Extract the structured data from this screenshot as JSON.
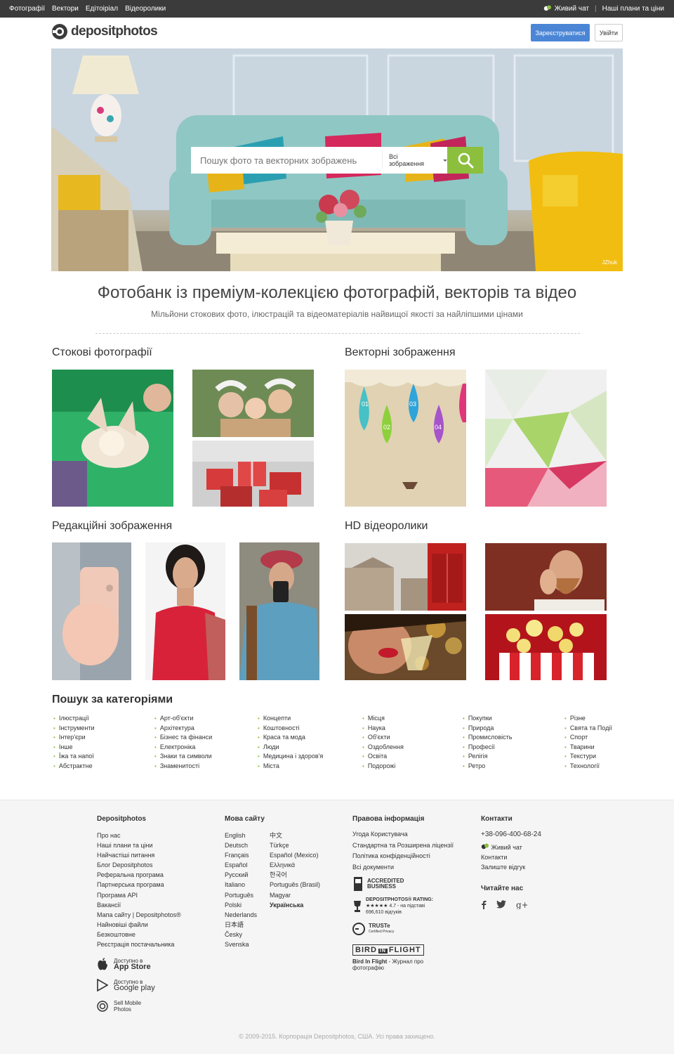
{
  "topbar": {
    "nav": [
      "Фотографії",
      "Вектори",
      "Едітоіріал",
      "Відеоролики"
    ],
    "live_chat": "Живий чат",
    "plans": "Наші плани та ціни"
  },
  "header": {
    "logo_text": "depositphotos",
    "register_label": "Зареєструватися",
    "login_label": "Увійти"
  },
  "hero": {
    "search_placeholder": "Пошук фото та векторних зображень",
    "filter_selected": "Всі зображення",
    "photo_credit": "JZhuk"
  },
  "headline": "Фотобанк із преміум-колекцією фотографій, векторів та відео",
  "subline": "Мільйони стокових фото, ілюстрацій та відеоматеріалів найвищої якості за найліпшими цінами",
  "sections": {
    "stock_photos": "Стокові фотографії",
    "vectors": "Векторні зображення",
    "editorial": "Редакційні зображення",
    "videos": "HD відеоролики"
  },
  "categories": {
    "title": "Пошук за категоріями",
    "columns": [
      [
        "Ілюстрації",
        "Інструменти",
        "Інтер'єри",
        "Інше",
        "Їжа та напої",
        "Абстрактне"
      ],
      [
        "Арт-об'єкти",
        "Архітектура",
        "Бізнес та фінанси",
        "Електроніка",
        "Знаки та символи",
        "Знаменитості"
      ],
      [
        "Концепти",
        "Коштовності",
        "Краса та мода",
        "Люди",
        "Медицина і здоров'я",
        "Міста"
      ],
      [
        "Місця",
        "Наука",
        "Об'єкти",
        "Оздоблення",
        "Освіта",
        "Подорожі"
      ],
      [
        "Покупки",
        "Природа",
        "Промисловість",
        "Професії",
        "Релігія",
        "Ретро"
      ],
      [
        "Різне",
        "Свята та Події",
        "Спорт",
        "Тварини",
        "Текстури",
        "Технології"
      ]
    ]
  },
  "footer": {
    "col1": {
      "title": "Depositphotos",
      "links": [
        "Про нас",
        "Наші плани та ціни",
        "Найчастіші питання",
        "Блог Depositphotos",
        "Реферальна програма",
        "Партнерська програма",
        "Програма API",
        "Вакансії",
        "Мапа сайту | Depositphotos®",
        "Найновіші файли",
        "Безкоштовне",
        "Реєстрація постачальника"
      ],
      "app_store_small": "Доступно в",
      "app_store": "App Store",
      "google_play_small": "Доступно в",
      "google_play": "Google play",
      "sell_mobile": "Sell Mobile Photos"
    },
    "col2": {
      "title": "Мова сайту",
      "langs_left": [
        "English",
        "Deutsch",
        "Français",
        "Español",
        "Русский",
        "Italiano",
        "Português",
        "Polski",
        "Nederlands",
        "日本語",
        "Česky",
        "Svenska"
      ],
      "langs_right": [
        "中文",
        "Türkçe",
        "Español (Mexico)",
        "Ελληνικά",
        "한국어",
        "Português (Brasil)",
        "Magyar",
        "Українська"
      ]
    },
    "col3": {
      "title": "Правова інформація",
      "links": [
        "Угода Користувача",
        "Стандартна та Розширена ліцензії",
        "Політика конфіденційності",
        "Всі документи"
      ],
      "bbb_line1": "ACCREDITED",
      "bbb_line2": "BUSINESS",
      "rating_title": "DEPOSITPHOTOS® RATING:",
      "rating_value": "4.7",
      "rating_suffix": "- на підставі",
      "rating_reviews": "696,610 відгуків",
      "truste": "TRUSTe",
      "truste_sub": "Certified Privacy",
      "bif_logo_a": "BIRD",
      "bif_logo_b": "IN",
      "bif_logo_c": "FLIGHT",
      "bif_name": "Bird In Flight",
      "bif_desc": "- Журнал про фотографію"
    },
    "col4": {
      "title": "Контакти",
      "phone": "+38-096-400-68-24",
      "live_chat": "Живий чат",
      "contacts": "Контакти",
      "feedback": "Залиште відгук",
      "follow_title": "Читайте нас"
    },
    "copyright": "© 2009-2015. Корпорація Depositphotos, США. Усі права захищено."
  },
  "colors": {
    "topbar": "#3b3b3b",
    "accent_green": "#8bbf3d",
    "register_blue": "#4b86d6",
    "footer_bg": "#f5f5f5"
  }
}
